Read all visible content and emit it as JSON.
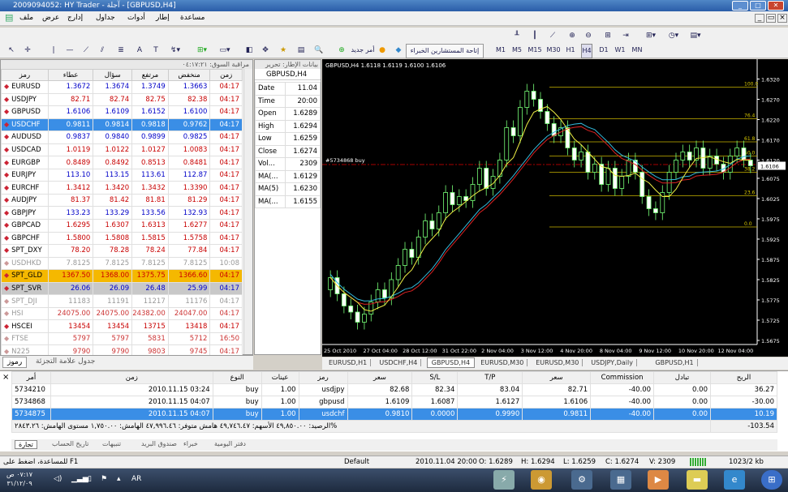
{
  "window": {
    "title": "2009094052: HY Trader - آجلة - [GBPUSD,H4]"
  },
  "menu": [
    "ملف",
    "عرض",
    "إدارج",
    "جداول",
    "أدوات",
    "إطار",
    "مساعدة"
  ],
  "toolbar": {
    "expert_advisors_label": "إتاحة المستشارين الخبراء",
    "new_order_label": "أمر جديد",
    "timeframes": [
      "M1",
      "M5",
      "M15",
      "M30",
      "H1",
      "H4",
      "D1",
      "W1",
      "MN"
    ]
  },
  "market_watch": {
    "header": "مراقبة السوق: ٠٤:١٧:٢١",
    "columns": [
      "رمز",
      "عطاء",
      "سؤال",
      "مرتفع",
      "منخفض",
      "زمن"
    ],
    "rows": [
      {
        "symbol": "EURUSD",
        "bid": "1.3672",
        "ask": "1.3674",
        "high": "1.3749",
        "low": "1.3663",
        "time": "04:17",
        "style": "up"
      },
      {
        "symbol": "USDJPY",
        "bid": "82.71",
        "ask": "82.74",
        "high": "82.75",
        "low": "82.38",
        "time": "04:17",
        "style": "down"
      },
      {
        "symbol": "GBPUSD",
        "bid": "1.6106",
        "ask": "1.6109",
        "high": "1.6152",
        "low": "1.6100",
        "time": "04:17",
        "style": "up"
      },
      {
        "symbol": "USDCHF",
        "bid": "0.9811",
        "ask": "0.9814",
        "high": "0.9818",
        "low": "0.9762",
        "time": "04:17",
        "style": "selected"
      },
      {
        "symbol": "AUDUSD",
        "bid": "0.9837",
        "ask": "0.9840",
        "high": "0.9899",
        "low": "0.9825",
        "time": "04:17",
        "style": "up"
      },
      {
        "symbol": "USDCAD",
        "bid": "1.0119",
        "ask": "1.0122",
        "high": "1.0127",
        "low": "1.0083",
        "time": "04:17",
        "style": "down"
      },
      {
        "symbol": "EURGBP",
        "bid": "0.8489",
        "ask": "0.8492",
        "high": "0.8513",
        "low": "0.8481",
        "time": "04:17",
        "style": "down"
      },
      {
        "symbol": "EURJPY",
        "bid": "113.10",
        "ask": "113.15",
        "high": "113.61",
        "low": "112.87",
        "time": "04:17",
        "style": "up"
      },
      {
        "symbol": "EURCHF",
        "bid": "1.3412",
        "ask": "1.3420",
        "high": "1.3432",
        "low": "1.3390",
        "time": "04:17",
        "style": "down"
      },
      {
        "symbol": "AUDJPY",
        "bid": "81.37",
        "ask": "81.42",
        "high": "81.81",
        "low": "81.29",
        "time": "04:17",
        "style": "down"
      },
      {
        "symbol": "GBPJPY",
        "bid": "133.23",
        "ask": "133.29",
        "high": "133.56",
        "low": "132.93",
        "time": "04:17",
        "style": "up"
      },
      {
        "symbol": "GBPCAD",
        "bid": "1.6295",
        "ask": "1.6307",
        "high": "1.6313",
        "low": "1.6277",
        "time": "04:17",
        "style": "down"
      },
      {
        "symbol": "GBPCHF",
        "bid": "1.5800",
        "ask": "1.5808",
        "high": "1.5815",
        "low": "1.5758",
        "time": "04:17",
        "style": "down"
      },
      {
        "symbol": "SPT_DXY",
        "bid": "78.20",
        "ask": "78.28",
        "high": "78.24",
        "low": "77.84",
        "time": "04:17",
        "style": "down"
      },
      {
        "symbol": "USDHKD",
        "bid": "7.8125",
        "ask": "7.8125",
        "high": "7.8125",
        "low": "7.8125",
        "time": "10:08",
        "style": "disabled"
      },
      {
        "symbol": "SPT_GLD",
        "bid": "1367.50",
        "ask": "1368.00",
        "high": "1375.75",
        "low": "1366.60",
        "time": "04:17",
        "style": "gold"
      },
      {
        "symbol": "SPT_SVR",
        "bid": "26.06",
        "ask": "26.09",
        "high": "26.48",
        "low": "25.99",
        "time": "04:17",
        "style": "silver"
      },
      {
        "symbol": "SPT_DJI",
        "bid": "11183",
        "ask": "11191",
        "high": "11217",
        "low": "11176",
        "time": "04:17",
        "style": "disabled"
      },
      {
        "symbol": "HSI",
        "bid": "24075.00",
        "ask": "24075.00",
        "high": "24382.00",
        "low": "24047.00",
        "time": "04:17",
        "style": "disabled-red"
      },
      {
        "symbol": "HSCEI",
        "bid": "13454",
        "ask": "13454",
        "high": "13715",
        "low": "13418",
        "time": "04:17",
        "style": "down"
      },
      {
        "symbol": "FTSE",
        "bid": "5797",
        "ask": "5797",
        "high": "5831",
        "low": "5712",
        "time": "16:50",
        "style": "disabled-red"
      },
      {
        "symbol": "N225",
        "bid": "9790",
        "ask": "9790",
        "high": "9803",
        "low": "9745",
        "time": "04:17",
        "style": "disabled-red"
      }
    ],
    "tabs": [
      "رموز",
      "جدول علامة التجزئة"
    ]
  },
  "data_window": {
    "header": "بيانات الإطار: تحرير",
    "symbol": "GBPUSD,H4",
    "rows": [
      {
        "label": "Date",
        "value": "11.04"
      },
      {
        "label": "Time",
        "value": "20:00"
      },
      {
        "label": "Open",
        "value": "1.6289"
      },
      {
        "label": "High",
        "value": "1.6294"
      },
      {
        "label": "Low",
        "value": "1.6259"
      },
      {
        "label": "Close",
        "value": "1.6274"
      },
      {
        "label": "Vol...",
        "value": "2309"
      },
      {
        "label": "MA(...",
        "value": "1.6129"
      },
      {
        "label": "MA(5)",
        "value": "1.6230"
      },
      {
        "label": "MA(...",
        "value": "1.6155"
      }
    ]
  },
  "chart_data": {
    "type": "candlestick",
    "title": "GBPUSD,H4  1.6118 1.6119 1.6100 1.6106",
    "order_label": "#5734868 buy",
    "current_price": "1.6106",
    "y_ticks": [
      "1.6320",
      "1.6270",
      "1.6220",
      "1.6170",
      "1.6120",
      "1.6075",
      "1.6025",
      "1.5975",
      "1.5925",
      "1.5875",
      "1.5825",
      "1.5775",
      "1.5725",
      "1.5675"
    ],
    "ylim": [
      1.5665,
      1.6345
    ],
    "x_ticks": [
      "25 Oct 2010",
      "27 Oct 04:00",
      "28 Oct 12:00",
      "31 Oct 22:00",
      "2 Nov 04:00",
      "3 Nov 12:00",
      "4 Nov 20:00",
      "8 Nov 04:00",
      "9 Nov 12:00",
      "10 Nov 20:00",
      "12 Nov 04:00"
    ],
    "fib_levels": [
      {
        "label": "100.0",
        "price": 1.63
      },
      {
        "label": "76.4",
        "price": 1.6222
      },
      {
        "label": "61.8",
        "price": 1.6165
      },
      {
        "label": "50.0",
        "price": 1.613
      },
      {
        "label": "38.2",
        "price": 1.609
      },
      {
        "label": "23.6",
        "price": 1.6032
      },
      {
        "label": "0.0",
        "price": 1.5955
      }
    ],
    "order_price": 1.6109,
    "closes": [
      1.583,
      1.579,
      1.576,
      1.5745,
      1.572,
      1.574,
      1.577,
      1.58,
      1.578,
      1.5825,
      1.586,
      1.59,
      1.588,
      1.593,
      1.597,
      1.595,
      1.599,
      1.604,
      1.601,
      1.603,
      1.602,
      1.606,
      1.61,
      1.605,
      1.608,
      1.612,
      1.62,
      1.618,
      1.625,
      1.629,
      1.627,
      1.624,
      1.621,
      1.618,
      1.62,
      1.615,
      1.612,
      1.614,
      1.609,
      1.611,
      1.606,
      1.61,
      1.605,
      1.608,
      1.612,
      1.609,
      1.603,
      1.6,
      1.599,
      1.604,
      1.609,
      1.612,
      1.614,
      1.612,
      1.615,
      1.61,
      1.613,
      1.611,
      1.609,
      1.613,
      1.615,
      1.612,
      1.6106
    ]
  },
  "chart_tabs": [
    "EURUSD,H1",
    "USDCHF,H4",
    "GBPUSD,H4",
    "EURUSD,M30",
    "EURUSD,M30",
    "USDJPY,Daily",
    "GBPUSD,H1"
  ],
  "terminal": {
    "columns": [
      "أمر",
      "زمن",
      "النوع",
      "عينات",
      "رمز",
      "سعر",
      "S/L",
      "T/P",
      "سعر",
      "Commission",
      "تبادل",
      "الربح"
    ],
    "orders": [
      {
        "order": "5734210",
        "time": "2010.11.15 03:24",
        "type": "buy",
        "size": "1.00",
        "symbol": "usdjpy",
        "price": "82.68",
        "sl": "82.34",
        "tp": "83.04",
        "cur": "82.71",
        "commission": "-40.00",
        "swap": "0.00",
        "profit": "36.27",
        "selected": false
      },
      {
        "order": "5734868",
        "time": "2010.11.15 04:07",
        "type": "buy",
        "size": "1.00",
        "symbol": "gbpusd",
        "price": "1.6109",
        "sl": "1.6087",
        "tp": "1.6127",
        "cur": "1.6106",
        "commission": "-40.00",
        "swap": "0.00",
        "profit": "-30.00",
        "selected": false
      },
      {
        "order": "5734875",
        "time": "2010.11.15 04:07",
        "type": "buy",
        "size": "1.00",
        "symbol": "usdchf",
        "price": "0.9810",
        "sl": "0.0000",
        "tp": "0.9990",
        "cur": "0.9811",
        "commission": "-40.00",
        "swap": "0.00",
        "profit": "10.19",
        "selected": true
      }
    ],
    "balance_line": "الرصيد: ٤٩,٨٥٠.٠٠  الأسهم: ٤٩,٧٤٦.٤٧  هامش متوفر: ٤٧,٩٩٦.٤٦  الهامش: ١,٧٥٠.٠٠  مستوى الهامش: ٢٨٤٣.٢٦%",
    "balance_profit": "-103.54",
    "tabs": [
      "تجارة",
      "تاريخ الحساب",
      "تنبيهات",
      "صندوق البريد",
      "خبراء",
      "دفتر اليومية"
    ]
  },
  "statusbar": {
    "help": "للمساعدة، اضغط على F1",
    "profile": "Default",
    "datetime": "2010.11.04 20:00",
    "open": "O: 1.6289",
    "high": "H: 1.6294",
    "low": "L: 1.6259",
    "close": "C: 1.6274",
    "volume": "V: 2309",
    "traffic": "1023/2 kb"
  },
  "taskbar": {
    "time": "٠٧:١٧ ص",
    "date": "٣١/١٢/٠٩",
    "lang": "AR"
  }
}
